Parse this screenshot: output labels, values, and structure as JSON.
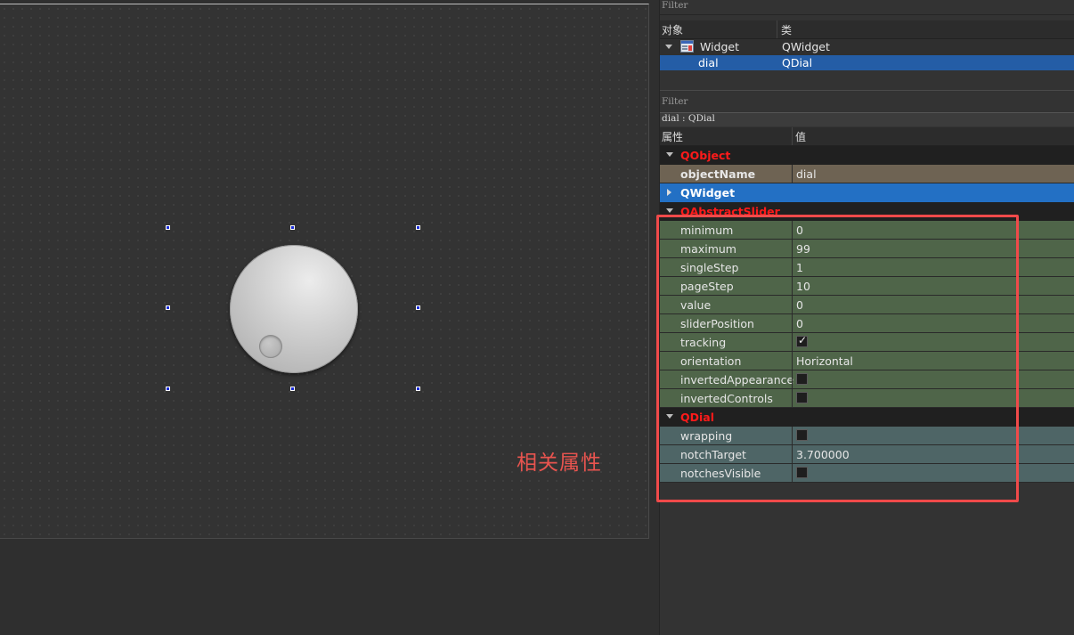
{
  "object_inspector": {
    "filter_label": "Filter",
    "columns": {
      "object": "对象",
      "class": "类"
    },
    "rows": [
      {
        "object": "Widget",
        "class": "QWidget",
        "icon": "widget-form-icon",
        "expanded": true
      },
      {
        "object": "dial",
        "class": "QDial",
        "selected": true
      }
    ]
  },
  "property_editor": {
    "filter_label": "Filter",
    "context": "dial : QDial",
    "columns": {
      "property": "属性",
      "value": "值"
    },
    "groups": {
      "qobject": "QObject",
      "qwidget": "QWidget",
      "qabstractslider": "QAbstractSlider",
      "qdial": "QDial"
    },
    "properties": {
      "objectName": {
        "name": "objectName",
        "value": "dial"
      },
      "minimum": {
        "name": "minimum",
        "value": "0"
      },
      "maximum": {
        "name": "maximum",
        "value": "99"
      },
      "singleStep": {
        "name": "singleStep",
        "value": "1"
      },
      "pageStep": {
        "name": "pageStep",
        "value": "10"
      },
      "value": {
        "name": "value",
        "value": "0"
      },
      "sliderPosition": {
        "name": "sliderPosition",
        "value": "0"
      },
      "tracking": {
        "name": "tracking",
        "checked": true
      },
      "orientation": {
        "name": "orientation",
        "value": "Horizontal"
      },
      "invertedAppearance": {
        "name": "invertedAppearance",
        "checked": false
      },
      "invertedControls": {
        "name": "invertedControls",
        "checked": false
      },
      "wrapping": {
        "name": "wrapping",
        "checked": false
      },
      "notchTarget": {
        "name": "notchTarget",
        "value": "3.700000"
      },
      "notchesVisible": {
        "name": "notchesVisible",
        "checked": false
      }
    }
  },
  "canvas": {
    "annotation": "相关属性"
  },
  "colors": {
    "accent_red": "#ff1a1a",
    "annotation_red": "#e8544f",
    "selection_blue": "#2370c4",
    "slider_group_green": "#4f6549",
    "dial_group_teal": "#4e6566"
  }
}
